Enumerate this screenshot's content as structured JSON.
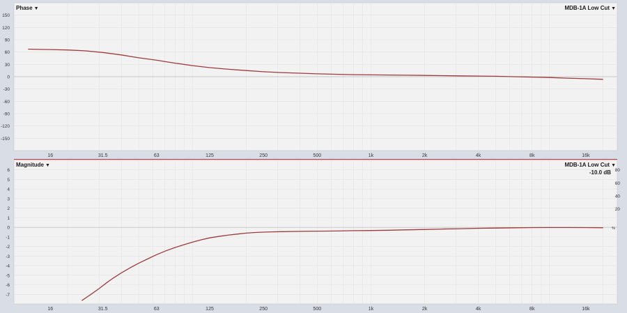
{
  "phase_panel": {
    "label": "Phase",
    "curve_label": "MDB-1A Low Cut",
    "dropdown_arrow": "▼"
  },
  "magnitude_panel": {
    "label": "Magnitude",
    "curve_label": "MDB-1A Low Cut",
    "dropdown_arrow": "▼",
    "offset_readout": "-10.0 dB",
    "right_scale_unit": "%"
  },
  "colors": {
    "curve": "#9c3b3b",
    "zero_line": "#b9b9b9",
    "plot_bg": "#f2f2f2",
    "frame_bg": "#d9dde6",
    "grid": "#e3e3e3"
  },
  "chart_data": [
    {
      "type": "line",
      "title": "Phase",
      "xscale": "log",
      "xlim": [
        10,
        24000
      ],
      "ylim": [
        -180,
        180
      ],
      "grid": true,
      "x_ticks": [
        {
          "v": 16,
          "label": "16"
        },
        {
          "v": 31.5,
          "label": "31.5"
        },
        {
          "v": 63,
          "label": "63"
        },
        {
          "v": 125,
          "label": "125"
        },
        {
          "v": 250,
          "label": "250"
        },
        {
          "v": 500,
          "label": "500"
        },
        {
          "v": 1000,
          "label": "1k"
        },
        {
          "v": 2000,
          "label": "2k"
        },
        {
          "v": 4000,
          "label": "4k"
        },
        {
          "v": 8000,
          "label": "8k"
        },
        {
          "v": 16000,
          "label": "16k"
        }
      ],
      "y_ticks": [
        150,
        120,
        90,
        60,
        30,
        0,
        -30,
        -60,
        -90,
        -120,
        -150
      ],
      "series": [
        {
          "name": "MDB-1A Low Cut",
          "x": [
            12,
            16,
            20,
            25,
            31.5,
            40,
            50,
            63,
            80,
            100,
            125,
            160,
            200,
            250,
            315,
            400,
            500,
            630,
            800,
            1000,
            1250,
            1600,
            2000,
            2500,
            3150,
            4000,
            5000,
            6300,
            8000,
            10000,
            12500,
            16000,
            20000
          ],
          "y": [
            67,
            66,
            65,
            63,
            59,
            53,
            46,
            40,
            33,
            27,
            22,
            18,
            15,
            12,
            10,
            8.5,
            7,
            6,
            5,
            4.5,
            4,
            3.5,
            3,
            2.5,
            2,
            1.5,
            1,
            0,
            -1,
            -2,
            -3.5,
            -5,
            -6.5
          ]
        }
      ]
    },
    {
      "type": "line",
      "title": "Magnitude",
      "xscale": "log",
      "xlim": [
        10,
        24000
      ],
      "ylim": [
        -8,
        7
      ],
      "grid": true,
      "x_ticks": [
        {
          "v": 16,
          "label": "16"
        },
        {
          "v": 31.5,
          "label": "31.5"
        },
        {
          "v": 63,
          "label": "63"
        },
        {
          "v": 125,
          "label": "125"
        },
        {
          "v": 250,
          "label": "250"
        },
        {
          "v": 500,
          "label": "500"
        },
        {
          "v": 1000,
          "label": "1k"
        },
        {
          "v": 2000,
          "label": "2k"
        },
        {
          "v": 4000,
          "label": "4k"
        },
        {
          "v": 8000,
          "label": "8k"
        },
        {
          "v": 16000,
          "label": "16k"
        }
      ],
      "y_ticks": [
        6,
        5,
        4,
        3,
        2,
        1,
        0,
        -1,
        -2,
        -3,
        -4,
        -5,
        -6,
        -7
      ],
      "y2_ticks": [
        80,
        60,
        40,
        20
      ],
      "y2_label": "%",
      "series": [
        {
          "name": "MDB-1A Low Cut",
          "x": [
            24,
            27,
            30,
            33,
            36,
            40,
            45,
            50,
            56,
            63,
            71,
            80,
            90,
            100,
            112,
            125,
            140,
            160,
            180,
            200,
            225,
            250,
            280,
            315,
            400,
            500,
            630,
            800,
            1000,
            1250,
            1600,
            2000,
            2500,
            3150,
            4000,
            5000,
            6300,
            8000,
            10000,
            12500,
            16000,
            20000
          ],
          "y": [
            -7.65,
            -7.0,
            -6.4,
            -5.8,
            -5.3,
            -4.75,
            -4.2,
            -3.75,
            -3.3,
            -2.85,
            -2.45,
            -2.1,
            -1.8,
            -1.55,
            -1.3,
            -1.1,
            -0.95,
            -0.8,
            -0.7,
            -0.6,
            -0.54,
            -0.5,
            -0.47,
            -0.45,
            -0.42,
            -0.4,
            -0.38,
            -0.35,
            -0.33,
            -0.3,
            -0.26,
            -0.22,
            -0.18,
            -0.14,
            -0.1,
            -0.08,
            -0.05,
            -0.03,
            -0.02,
            -0.02,
            -0.03,
            -0.04
          ]
        }
      ]
    }
  ]
}
